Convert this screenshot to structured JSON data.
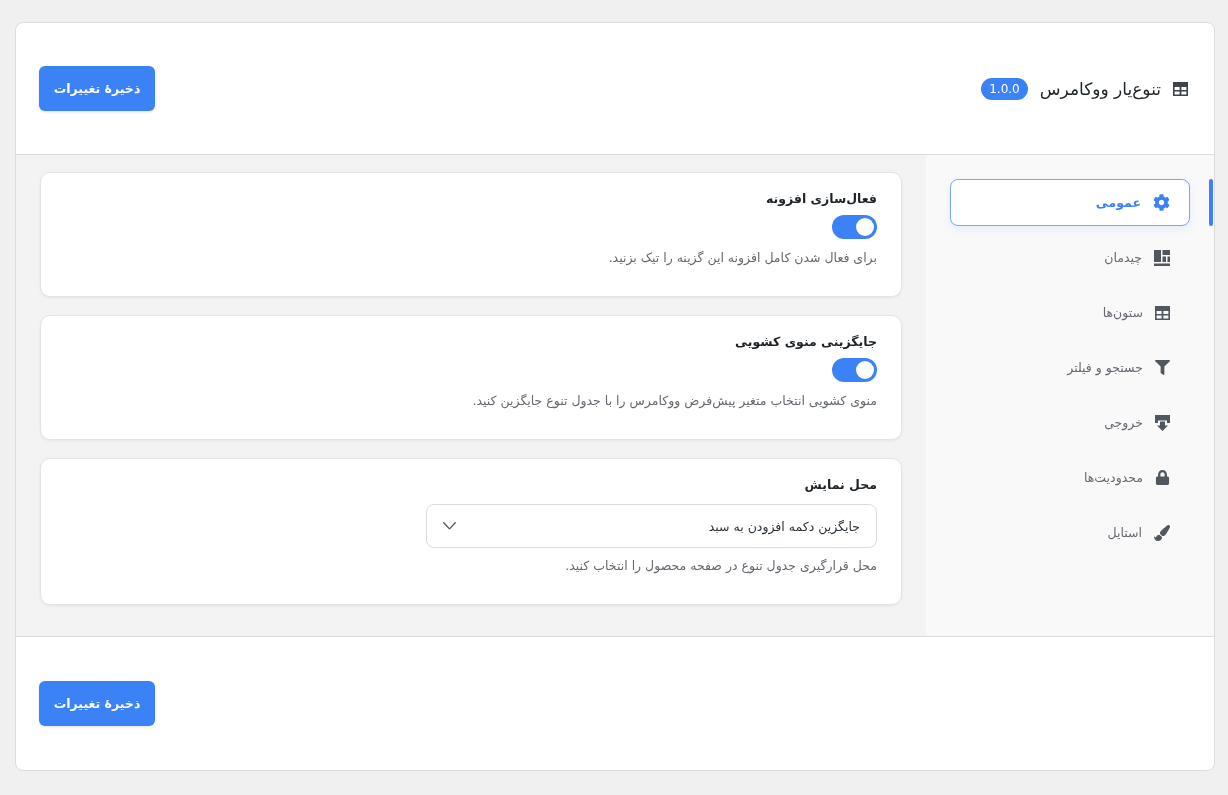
{
  "header": {
    "title": "تنوع‌یار ووکامرس",
    "version": "1.0.0",
    "save_button": "ذخیرهٔ تغییرات"
  },
  "sidebar": {
    "items": [
      {
        "label": "عمومی",
        "selected": true
      },
      {
        "label": "چیدمان",
        "selected": false
      },
      {
        "label": "ستون‌ها",
        "selected": false
      },
      {
        "label": "جستجو و فیلتر",
        "selected": false
      },
      {
        "label": "خروجی",
        "selected": false
      },
      {
        "label": "محدودیت‌ها",
        "selected": false
      },
      {
        "label": "استایل",
        "selected": false
      }
    ]
  },
  "settings": [
    {
      "kind": "toggle",
      "title": "فعال‌سازی افزونه",
      "on": true,
      "description": "برای فعال شدن کامل افزونه این گزینه را تیک بزنید."
    },
    {
      "kind": "toggle",
      "title": "جایگزینی منوی کشویی",
      "on": true,
      "description": "منوی کشویی انتخاب متغیر پیش‌فرض ووکامرس را با جدول تنوع جایگزین کنید."
    },
    {
      "kind": "select",
      "title": "محل نمایش",
      "value": "جایگزین دکمه افزودن به سبد",
      "description": "محل قرارگیری جدول تنوع در صفحه محصول را انتخاب کنید."
    }
  ],
  "footer": {
    "save_button": "ذخیرهٔ تغییرات"
  }
}
